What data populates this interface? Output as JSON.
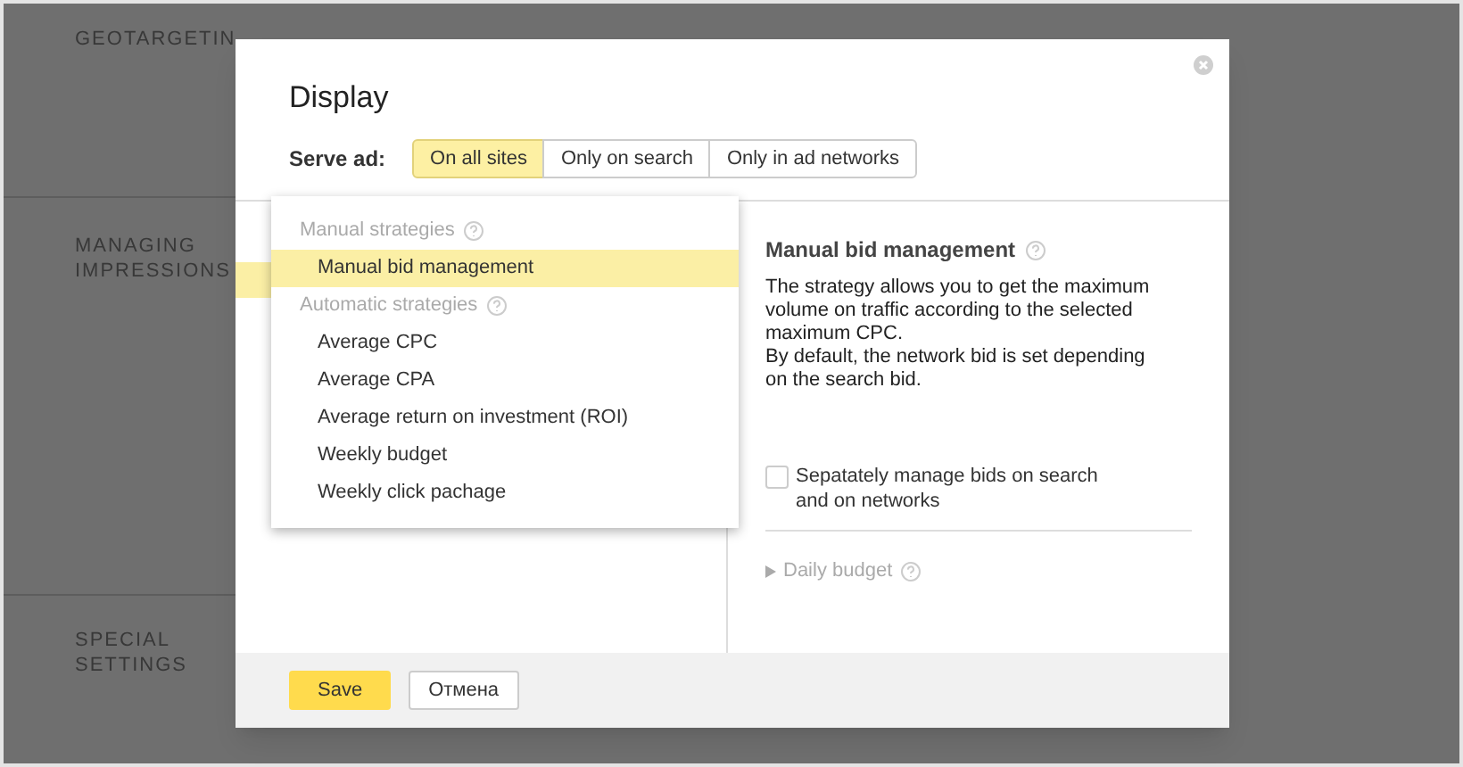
{
  "background": {
    "sections": [
      {
        "label": "GEOTARGETIN"
      },
      {
        "label": "MANAGING IMPRESSIONS"
      },
      {
        "label": "SPECIAL SETTINGS"
      }
    ]
  },
  "dialog": {
    "title": "Display",
    "serve_ad": {
      "label": "Serve ad:",
      "options": [
        {
          "label": "On all sites",
          "selected": true
        },
        {
          "label": "Only on search",
          "selected": false
        },
        {
          "label": "Only in ad networks",
          "selected": false
        }
      ]
    },
    "strategy_menu": {
      "groups": [
        {
          "label": "Manual strategies",
          "items": [
            {
              "label": "Manual bid management",
              "selected": true
            }
          ]
        },
        {
          "label": "Automatic strategies",
          "items": [
            {
              "label": "Average CPC",
              "selected": false
            },
            {
              "label": "Average CPA",
              "selected": false
            },
            {
              "label": "Average return on investment (ROI)",
              "selected": false
            },
            {
              "label": "Weekly budget",
              "selected": false
            },
            {
              "label": "Weekly click pachage",
              "selected": false
            }
          ]
        }
      ]
    },
    "details": {
      "title": "Manual bid management",
      "description": [
        "The strategy allows you to get the maximum volume on traffic according to the selected maximum CPC.",
        "By default, the network bid is set depending on the search bid."
      ],
      "separate_bids": {
        "label": "Sepatately manage bids on search and on networks",
        "checked": false
      },
      "daily_budget": {
        "label": "Daily budget",
        "expanded": false
      }
    },
    "buttons": [
      {
        "kind": "primary",
        "label": "Save"
      },
      {
        "kind": "secondary",
        "label": "Отмена"
      }
    ]
  }
}
